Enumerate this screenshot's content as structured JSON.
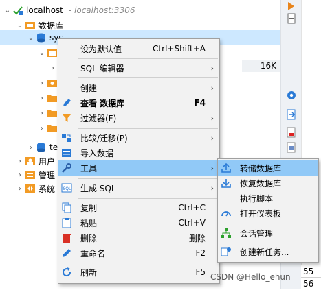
{
  "tree": {
    "host": "localhost",
    "host_sub": "- localhost:3306",
    "databases": "数据库",
    "sys": "sys",
    "te": "te",
    "users": "用户",
    "manage": "管理",
    "system": "系统",
    "value_16k": "16K"
  },
  "right_numbers": [
    "55",
    "56"
  ],
  "context_menu": {
    "set_default": "设为默认值",
    "set_default_sc": "Ctrl+Shift+A",
    "sql_editor": "SQL 编辑器",
    "create": "创建",
    "view_db": "查看 数据库",
    "view_db_sc": "F4",
    "filter": "过滤器(F)",
    "compare": "比较/迁移(P)",
    "import": "导入数据",
    "tools": "工具",
    "gen_sql": "生成 SQL",
    "copy": "复制",
    "copy_sc": "Ctrl+C",
    "paste": "粘贴",
    "paste_sc": "Ctrl+V",
    "delete": "删除",
    "delete_sc": "删除",
    "rename": "重命名",
    "rename_sc": "F2",
    "refresh": "刷新",
    "refresh_sc": "F5"
  },
  "tools_menu": {
    "dump": "转储数据库",
    "restore": "恢复数据库",
    "run_script": "执行脚本",
    "dashboard": "打开仪表板",
    "session": "会话管理",
    "new_task": "创建新任务..."
  },
  "watermark": "CSDN @Hello_ehun",
  "colors": {
    "highlight": "#91c9f7",
    "selection": "#cde8ff",
    "folder": "#f29b25",
    "accent": "#2a7ad6"
  }
}
